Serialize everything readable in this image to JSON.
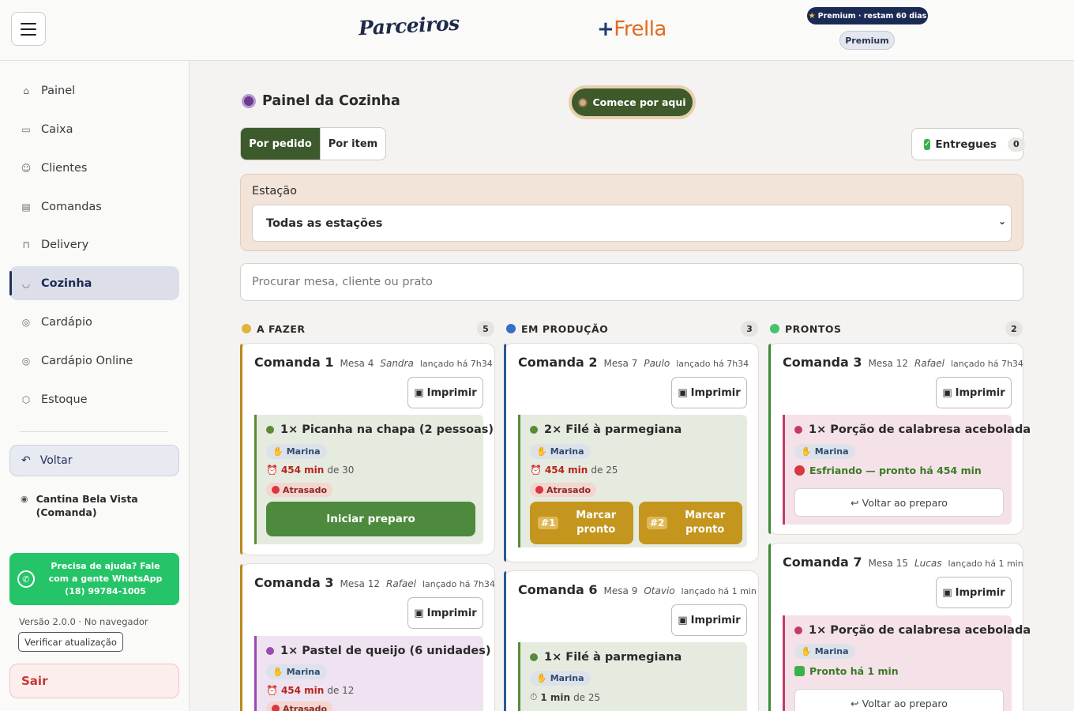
{
  "header": {
    "brand_left": "Parceiros",
    "brand_right_plus": "+",
    "brand_right_word": "Frella",
    "premium_pill": "Premium · restam 60 dias",
    "premium_button": "Premium"
  },
  "sidebar": {
    "items": [
      {
        "label": "Painel",
        "icon": "home-icon"
      },
      {
        "label": "Caixa",
        "icon": "cash-icon"
      },
      {
        "label": "Clientes",
        "icon": "users-icon"
      },
      {
        "label": "Comandas",
        "icon": "clipboard-icon"
      },
      {
        "label": "Delivery",
        "icon": "bag-icon"
      },
      {
        "label": "Cozinha",
        "icon": "pot-icon"
      },
      {
        "label": "Cardápio",
        "icon": "menu-icon"
      },
      {
        "label": "Cardápio Online",
        "icon": "menu-online-icon"
      },
      {
        "label": "Estoque",
        "icon": "box-icon"
      }
    ],
    "active": "Cozinha",
    "voltar": "Voltar",
    "store_line1": "Cantina Bela Vista",
    "store_line2": "(Comanda)",
    "help_text": "Precisa de ajuda? Fale com a gente WhatsApp (18) 99784-1005",
    "version": "Versão 2.0.0 · No navegador",
    "update_button": "Verificar atualização",
    "logout": "Sair"
  },
  "main": {
    "title": "Painel da Cozinha",
    "start_button": "Comece por aqui",
    "tabs": [
      "Por pedido",
      "Por item"
    ],
    "delivered_label": "Entregues",
    "delivered_count": "0",
    "station_label": "Estação",
    "station_value": "Todas as estações",
    "search_placeholder": "Procurar mesa, cliente ou prato",
    "colors": {
      "todo": "#b8891c",
      "prod": "#2c5a94",
      "ready": "#3f8a36",
      "gold": "#c4961e",
      "green_btn": "#4d8a3d"
    }
  },
  "columns": [
    {
      "title": "A FAZER",
      "count": "5"
    },
    {
      "title": "EM PRODUÇÃO",
      "count": "3"
    },
    {
      "title": "PRONTOS",
      "count": "2"
    }
  ],
  "cards": {
    "todo1": {
      "comanda": "Comanda 1",
      "mesa": "Mesa 4",
      "waiter": "Sandra",
      "time": "lançado há 7h34",
      "print": "Imprimir",
      "item": "1× Picanha na chapa (2 pessoas)",
      "chef": "Marina",
      "timer_value": "454 min",
      "timer_rest": "de 30",
      "late": "Atrasado",
      "action": "Iniciar preparo"
    },
    "todo2": {
      "comanda": "Comanda 3",
      "mesa": "Mesa 12",
      "waiter": "Rafael",
      "time": "lançado há 7h34",
      "print": "Imprimir",
      "item": "1× Pastel de queijo (6 unidades)",
      "chef": "Marina",
      "timer_value": "454 min",
      "timer_rest": "de 12",
      "late": "Atrasado"
    },
    "prod1": {
      "comanda": "Comanda 2",
      "mesa": "Mesa 7",
      "waiter": "Paulo",
      "time": "lançado há 7h34",
      "print": "Imprimir",
      "item": "2× Filé à parmegiana",
      "chef": "Marina",
      "timer_value": "454 min",
      "timer_rest": "de 25",
      "late": "Atrasado",
      "btn1_num": "#1",
      "btn2_num": "#2",
      "btn_label": "Marcar pronto"
    },
    "prod2": {
      "comanda": "Comanda 6",
      "mesa": "Mesa 9",
      "waiter": "Otavio",
      "time": "lançado há 1 min",
      "print": "Imprimir",
      "item": "1× Filé à parmegiana",
      "chef": "Marina",
      "timer_value": "1 min",
      "timer_rest": "de 25"
    },
    "ready1": {
      "comanda": "Comanda 3",
      "mesa": "Mesa 12",
      "waiter": "Rafael",
      "time": "lançado há 7h34",
      "print": "Imprimir",
      "item": "1× Porção de calabresa acebolada",
      "chef": "Marina",
      "status": "Esfriando — pronto há 454 min",
      "back": "Voltar ao preparo"
    },
    "ready2": {
      "comanda": "Comanda 7",
      "mesa": "Mesa 15",
      "waiter": "Lucas",
      "time": "lançado há 1 min",
      "print": "Imprimir",
      "item": "1× Porção de calabresa acebolada",
      "chef": "Marina",
      "status": "Pronto há 1 min",
      "back": "Voltar ao preparo"
    }
  }
}
